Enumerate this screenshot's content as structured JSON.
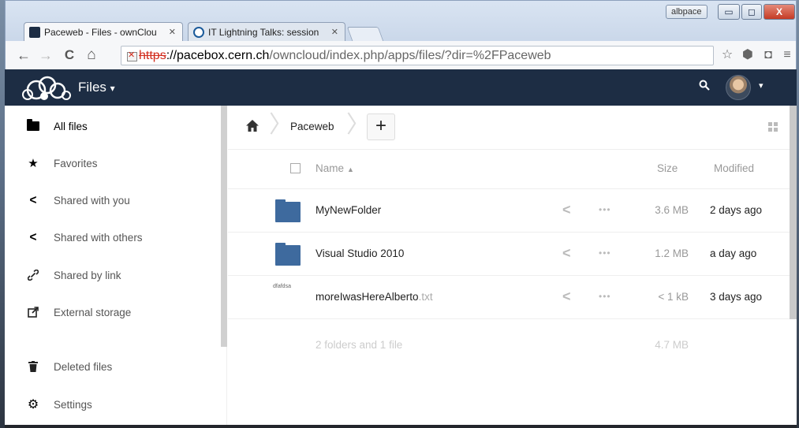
{
  "browser": {
    "tabs": [
      {
        "label": "Paceweb - Files - ownClou",
        "close": "✕"
      },
      {
        "label": "IT Lightning Talks: session",
        "close": "✕"
      }
    ],
    "profile": "albpace",
    "window_controls": {
      "minimize": "▭",
      "maximize": "◻",
      "close": "X"
    },
    "url": {
      "scheme": "https",
      "rest_host": "://pacebox.cern.ch",
      "path": "/owncloud/index.php/apps/files/?dir=%2FPaceweb"
    },
    "nav": {
      "back": "←",
      "forward": "→",
      "reload": "C",
      "home": "⌂"
    },
    "toolbar_icons": {
      "star": "☆",
      "extension": "⬢",
      "pocket": "◘",
      "menu": "≡"
    }
  },
  "app": {
    "name": "Files",
    "caret": "▾",
    "search_icon": "🔍",
    "user_caret": "▾"
  },
  "sidebar": {
    "items": [
      {
        "label": "All files",
        "icon": "folder-icon"
      },
      {
        "label": "Favorites",
        "icon": "star-icon",
        "glyph": "★"
      },
      {
        "label": "Shared with you",
        "icon": "share-icon",
        "glyph": "<"
      },
      {
        "label": "Shared with others",
        "icon": "share-icon",
        "glyph": "<"
      },
      {
        "label": "Shared by link",
        "icon": "link-icon",
        "glyph": "🔗"
      },
      {
        "label": "External storage",
        "icon": "external-icon",
        "glyph": "⬈"
      },
      {
        "label": "Deleted files",
        "icon": "trash-icon",
        "glyph": "🗑"
      },
      {
        "label": "Settings",
        "icon": "gear-icon",
        "glyph": "⚙"
      }
    ]
  },
  "breadcrumb": {
    "home_icon": "home-icon",
    "crumb": "Paceweb",
    "add_label": "+"
  },
  "table": {
    "columns": {
      "name": "Name",
      "sort": "▲",
      "size": "Size",
      "modified": "Modified"
    },
    "rows": [
      {
        "name": "MyNewFolder",
        "ext": "",
        "type": "folder",
        "size": "3.6 MB",
        "modified": "2 days ago"
      },
      {
        "name": "Visual Studio 2010",
        "ext": "",
        "type": "folder",
        "size": "1.2 MB",
        "modified": "a day ago"
      },
      {
        "name": "moreIwasHereAlberto",
        "ext": ".txt",
        "type": "file",
        "thumb": "dfafdsa",
        "size": "< 1 kB",
        "modified": "3 days ago"
      }
    ],
    "share_glyph": "<",
    "more_glyph": "•••",
    "summary": {
      "text": "2 folders and 1 file",
      "size": "4.7 MB"
    }
  }
}
